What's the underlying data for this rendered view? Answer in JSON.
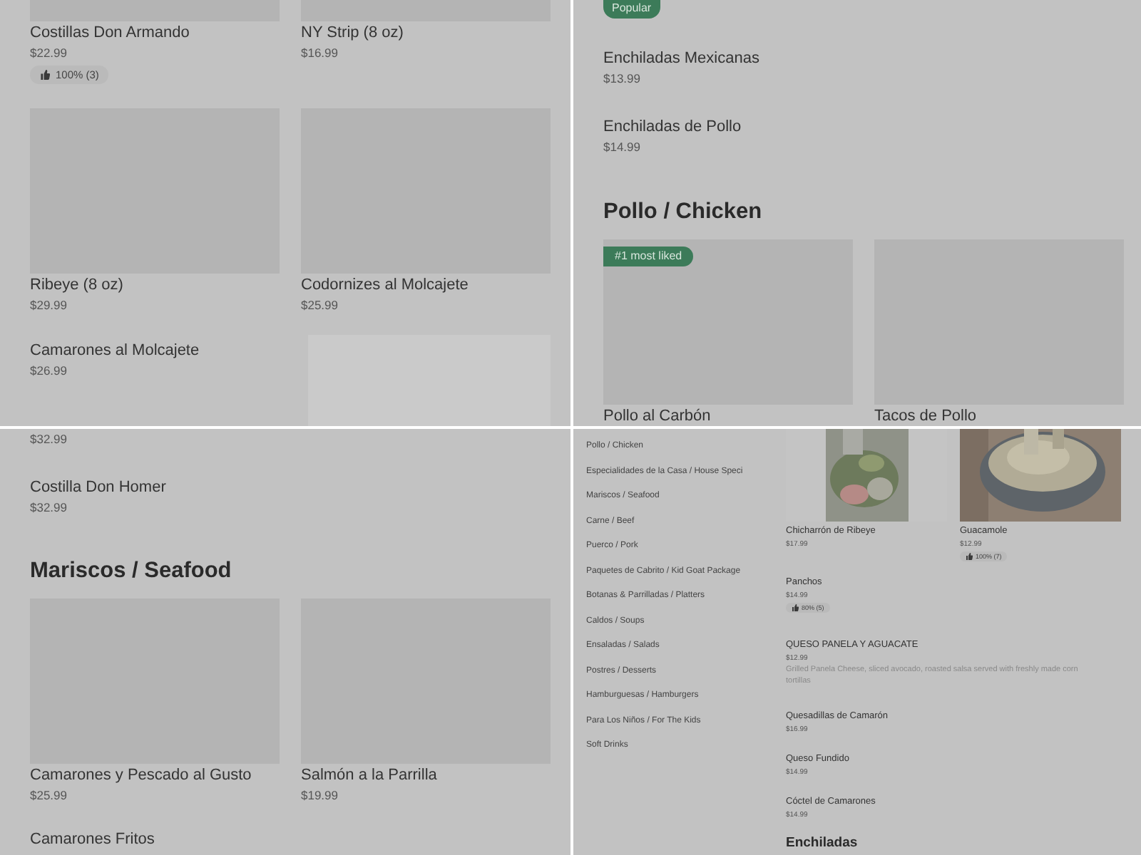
{
  "panels": [
    {
      "kind": "full",
      "blocks": [
        {
          "kind": "cards",
          "cut": true,
          "cards": [
            {
              "name": "Costillas Don Armando",
              "price": "$22.99",
              "rating": "100% (3)"
            },
            {
              "name": "NY Strip (8 oz)",
              "price": "$16.99"
            }
          ]
        },
        {
          "kind": "cards",
          "cut": false,
          "cards": [
            {
              "name": "Ribeye (8 oz)",
              "price": "$29.99"
            },
            {
              "name": "Codornizes al Molcajete",
              "price": "$25.99"
            }
          ]
        },
        {
          "kind": "item",
          "name": "Camarones al Molcajete",
          "price": "$26.99",
          "side_image": true
        }
      ]
    },
    {
      "kind": "full",
      "blocks": [
        {
          "kind": "badge",
          "text": "Popular"
        },
        {
          "kind": "item",
          "name": "Enchiladas Mexicanas",
          "price": "$13.99"
        },
        {
          "kind": "item",
          "name": "Enchiladas de Pollo",
          "price": "$14.99"
        },
        {
          "kind": "heading",
          "text": "Pollo / Chicken"
        },
        {
          "kind": "cards",
          "cut": false,
          "cards": [
            {
              "name": "Pollo al Carbón",
              "badge": "#1 most liked"
            },
            {
              "name": "Tacos de Pollo"
            }
          ]
        }
      ]
    },
    {
      "kind": "full",
      "blocks": [
        {
          "kind": "price",
          "text": "$32.99"
        },
        {
          "kind": "item",
          "name": "Costilla Don Homer",
          "price": "$32.99"
        },
        {
          "kind": "heading",
          "text": "Mariscos / Seafood"
        },
        {
          "kind": "cards",
          "cut": false,
          "cards": [
            {
              "name": "Camarones y Pescado al Gusto",
              "price": "$25.99"
            },
            {
              "name": "Salmón a la Parrilla",
              "price": "$19.99"
            }
          ]
        },
        {
          "kind": "item",
          "name": "Camarones Fritos"
        }
      ]
    },
    {
      "kind": "compact",
      "sidebar": [
        "Pollo / Chicken",
        "Especialidades de la Casa / House Speci",
        "Mariscos / Seafood",
        "Carne / Beef",
        "Puerco / Pork",
        "Paquetes de Cabrito / Kid Goat Package",
        "Botanas & Parrilladas / Platters",
        "Caldos / Soups",
        "Ensaladas / Salads",
        "Postres / Desserts",
        "Hamburguesas / Hamburgers",
        "Para Los Niños / For The Kids",
        "Soft Drinks"
      ],
      "blocks": [
        {
          "kind": "cards",
          "cut": true,
          "cards": [
            {
              "name": "Chicharrón de Ribeye",
              "price": "$17.99",
              "picture": true
            },
            {
              "name": "Guacamole",
              "price": "$12.99",
              "rating": "100% (7)",
              "picture": true
            }
          ]
        },
        {
          "kind": "item",
          "name": "Panchos",
          "price": "$14.99",
          "rating": "80% (5)"
        },
        {
          "kind": "item",
          "name": "QUESO PANELA Y AGUACATE",
          "price": "$12.99",
          "description": "Grilled Panela Cheese, sliced avocado, roasted salsa served with freshly made corn tortillas"
        },
        {
          "kind": "item",
          "name": "Quesadillas de Camarón",
          "price": "$16.99"
        },
        {
          "kind": "item",
          "name": "Queso Fundido",
          "price": "$14.99"
        },
        {
          "kind": "item",
          "name": "Cóctel de Camarones",
          "price": "$14.99"
        },
        {
          "kind": "heading",
          "text": "Enchiladas"
        }
      ]
    }
  ]
}
